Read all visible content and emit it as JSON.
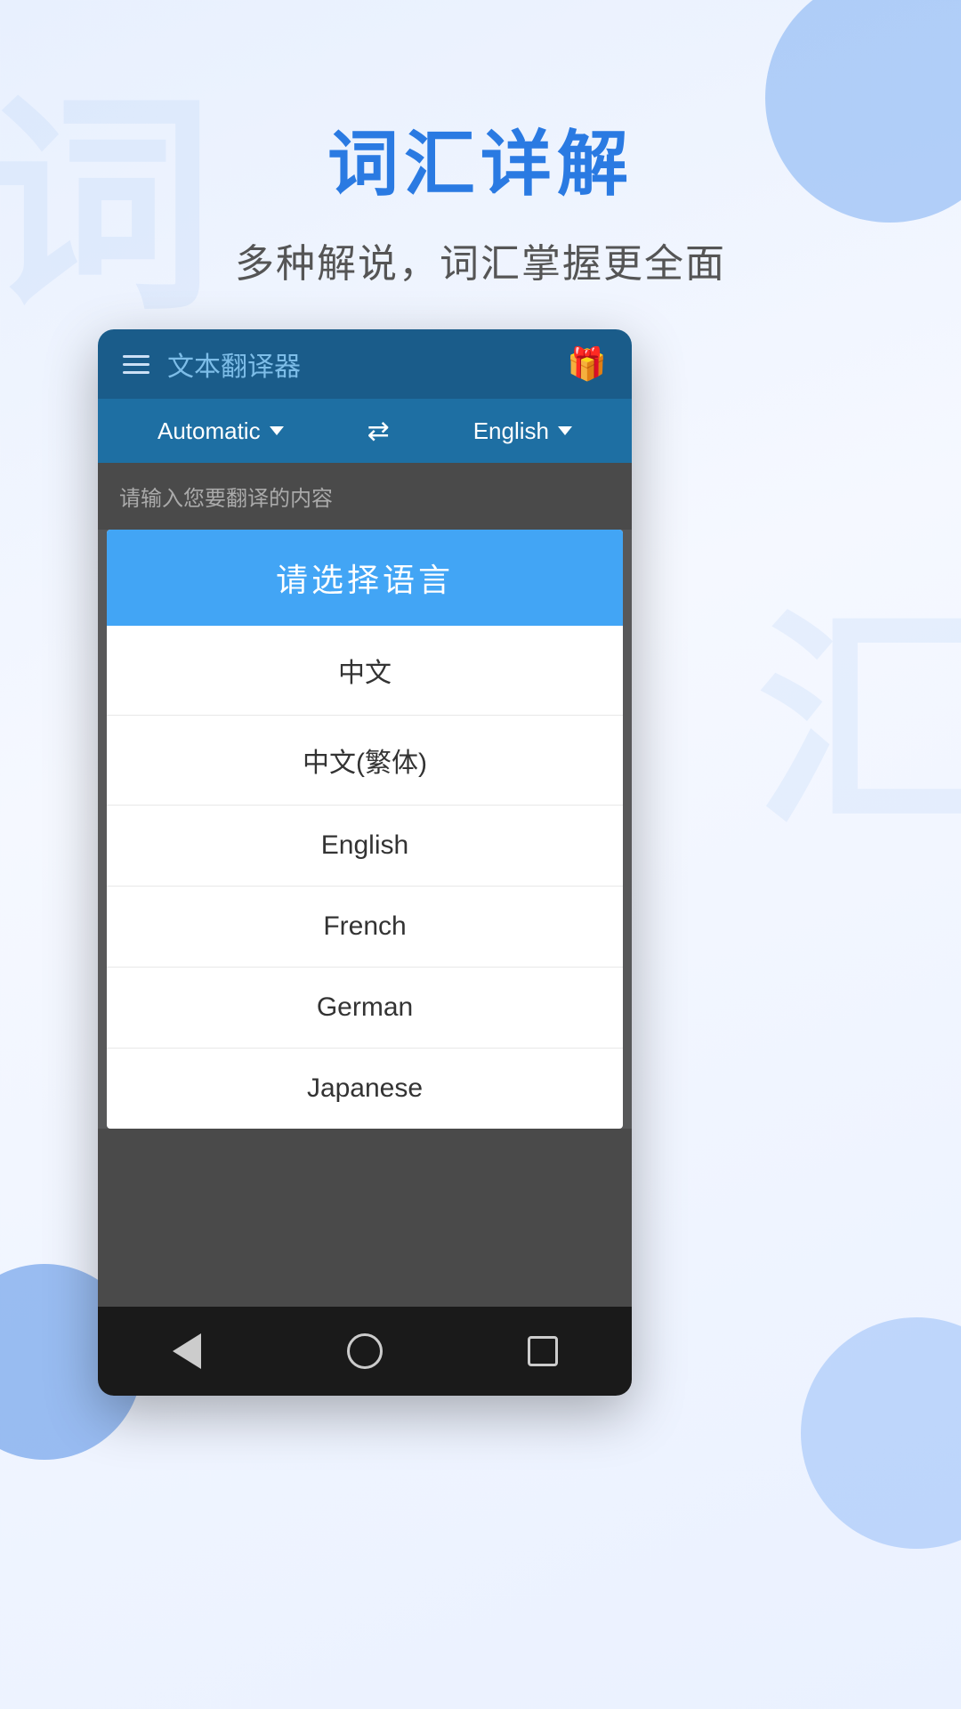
{
  "page": {
    "background": "#eaf1ff"
  },
  "header": {
    "main_title": "词汇详解",
    "sub_title": "多种解说，词汇掌握更全面"
  },
  "app": {
    "title": "文本翻译器",
    "source_lang": "Automatic",
    "target_lang": "English",
    "input_placeholder": "请输入您要翻译的内容"
  },
  "dialog": {
    "title": "请选择语言",
    "options": [
      {
        "label": "中文"
      },
      {
        "label": "中文(繁体)"
      },
      {
        "label": "English"
      },
      {
        "label": "French"
      },
      {
        "label": "German"
      },
      {
        "label": "Japanese"
      }
    ]
  },
  "navbar": {
    "back": "back",
    "home": "home",
    "recent": "recent"
  },
  "icons": {
    "menu": "menu-icon",
    "gift": "🎁",
    "swap": "⇄"
  }
}
